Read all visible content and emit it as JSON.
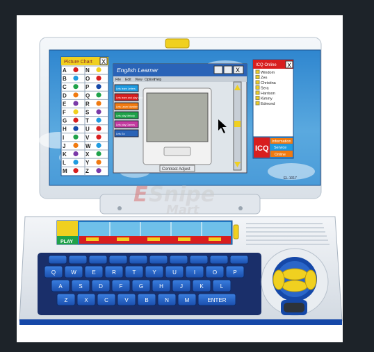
{
  "sticker": {
    "title": "Picture Chart",
    "close_glyph": "X",
    "rows": [
      {
        "letters": [
          "A",
          "N"
        ]
      },
      {
        "letters": [
          "B",
          "O"
        ]
      },
      {
        "letters": [
          "C",
          "P"
        ]
      },
      {
        "letters": [
          "D",
          "Q"
        ]
      },
      {
        "letters": [
          "E",
          "R"
        ]
      },
      {
        "letters": [
          "F",
          "S"
        ]
      },
      {
        "letters": [
          "G",
          "T"
        ]
      },
      {
        "letters": [
          "H",
          "U"
        ]
      },
      {
        "letters": [
          "I",
          "V"
        ]
      },
      {
        "letters": [
          "J",
          "W"
        ]
      },
      {
        "letters": [
          "K",
          "X"
        ]
      },
      {
        "letters": [
          "L",
          "Y"
        ]
      },
      {
        "letters": [
          "M",
          "Z"
        ]
      }
    ]
  },
  "app_window": {
    "title": "English Learner",
    "menu": [
      "File",
      "Edit",
      "View",
      "Option",
      "Help"
    ],
    "buttons": [
      "Lets learn Letters",
      "Lets learn and play Words",
      "Lets Learn Number",
      "Lets play Melody",
      "Lets play Games",
      "Lets Go"
    ],
    "contrast_label": "Contrast Adjust"
  },
  "contacts": {
    "header": "ICQ Online",
    "names": [
      "Windom",
      "Zen",
      "Christina",
      "Sera",
      "Harrison",
      "Kimmy",
      "Edmond"
    ],
    "icq": "ICQ",
    "info": "Information",
    "service": "Service",
    "online": "Online"
  },
  "bezel_model": "EL-1017",
  "watermark": {
    "line1": "Snipe",
    "line2": "Mart"
  },
  "keyboard": {
    "row1": [
      "Q",
      "W",
      "E",
      "R",
      "T",
      "Y",
      "U",
      "I",
      "O",
      "P"
    ],
    "row2": [
      "A",
      "S",
      "D",
      "F",
      "G",
      "H",
      "J",
      "K",
      "L"
    ],
    "row3": [
      "Z",
      "X",
      "C",
      "V",
      "B",
      "N",
      "M",
      "ENTER"
    ],
    "play": "PLAY"
  },
  "colors": {
    "page_bg": "#1d2329",
    "laptop_white": "#e9edf1",
    "screen_sky": "#3f95d4",
    "key_blue": "#1d5fc5",
    "mouse_yellow": "#f0d020",
    "accent_red": "#d81e1e",
    "base_blue": "#1548a8"
  }
}
